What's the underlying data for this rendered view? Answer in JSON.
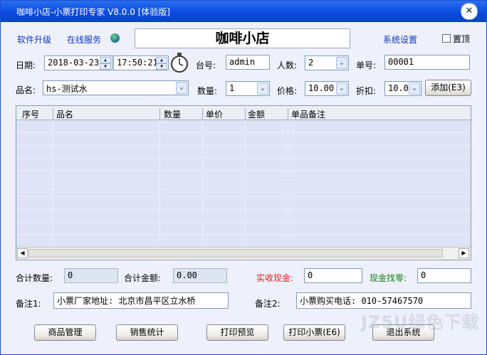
{
  "window": {
    "title": "咖啡小店-小票打印专家 V8.0.0 [体验版]",
    "close": "✕"
  },
  "toolbar": {
    "upgrade": "软件升级",
    "online": "在线服务",
    "settings": "系统设置",
    "pin_label": "置顶"
  },
  "shop_name": "咖啡小店",
  "form": {
    "date_label": "日期:",
    "date": "2018-03-23",
    "time": "17:50:21",
    "table_label": "台号:",
    "table": "admin",
    "people_label": "人数:",
    "people": "2",
    "order_label": "单号:",
    "order": "00001",
    "item_label": "品名:",
    "item": "hs-测试水",
    "qty_label": "数量:",
    "qty": "1",
    "price_label": "价格:",
    "price": "10.00",
    "discount_label": "折扣:",
    "discount": "10.0",
    "add_button": "添加(E3)"
  },
  "grid": {
    "columns": [
      "序号",
      "品名",
      "数量",
      "单价",
      "金额",
      "单品备注"
    ]
  },
  "totals": {
    "qty_label": "合计数量:",
    "qty": "0",
    "amount_label": "合计金额:",
    "amount": "0.00",
    "cash_label": "实收现金:",
    "cash": "0",
    "change_label": "现金找零:",
    "change": "0"
  },
  "notes": {
    "note1_label": "备注1:",
    "note1": "小票厂家地址: 北京市昌平区立水桥",
    "note2_label": "备注2:",
    "note2": "小票购买电话: 010-57467570"
  },
  "buttons": {
    "goods": "商品管理",
    "stats": "销售统计",
    "preview": "打印预览",
    "print": "打印小票(E6)",
    "exit": "退出系统"
  },
  "watermark": "JZ5U绿色下载"
}
